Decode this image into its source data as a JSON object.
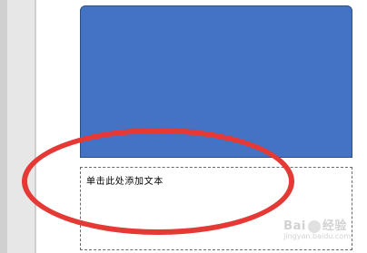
{
  "slide": {
    "placeholder_text": "单击此处添加文本"
  },
  "colors": {
    "shape_fill": "#4472c4",
    "highlight_ring": "#e53935",
    "canvas": "#ffffff"
  },
  "watermark": {
    "text": "Bai",
    "text2": "经验",
    "sub": "jingyan.baidu.com"
  }
}
